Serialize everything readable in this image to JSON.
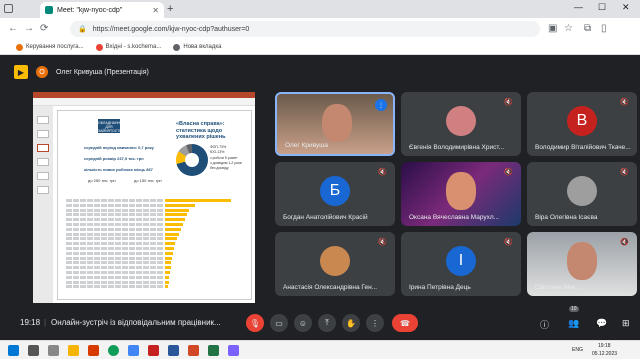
{
  "browser": {
    "tab_title": "Meet: \"kjw-nyoc-cdp\"",
    "url": "https://meet.google.com/kjw-nyoc-cdp?authuser=0",
    "bookmarks": [
      {
        "label": "Керування послуга...",
        "color": "#e8710a"
      },
      {
        "label": "Вхідні - s.kochema...",
        "color": "#ea4335"
      },
      {
        "label": "Нова вкладка",
        "color": "#5f6368"
      }
    ]
  },
  "meet": {
    "presenter_initial": "О",
    "presenter_label": "Олег Кривуша (Презентація)",
    "slide": {
      "logo_text": "ОБЛАДНАННЯ ДЛЯ ЗАЙНЯТОСТІ",
      "title": "«Власна справа»: статистика щодо ухвалених рішень",
      "stats": [
        "середній період навчання: 0,7 року",
        "середній розмір 237,9 тис. грн",
        "кількість нових робочих місць 867",
        "до 250 тис. грн",
        "до 150 тис. грн"
      ],
      "legend": [
        "ФОП-73%",
        "ЮО-13%",
        "з роботи 5 років+",
        "з досвідом 1-2 роки",
        "без досвіду"
      ]
    },
    "tiles": [
      {
        "name": "Олег Кривуша",
        "type": "video",
        "speaking": true
      },
      {
        "name": "Євгенія Володимирівна Христ...",
        "type": "photo",
        "color": "#d08080"
      },
      {
        "name": "Володимир Віталійович Ткаче...",
        "type": "letter",
        "letter": "В",
        "color": "#c5221f"
      },
      {
        "name": "Богдан Анатолійович Красій",
        "type": "letter",
        "letter": "Б",
        "color": "#1967d2"
      },
      {
        "name": "Оксана Вячеславна Марухл...",
        "type": "video"
      },
      {
        "name": "Віра Олегівна Ісаєва",
        "type": "photo",
        "color": "#9e9e9e"
      },
      {
        "name": "Анастасія Олександрівна Ген...",
        "type": "photo",
        "color": "#c98850"
      },
      {
        "name": "Ірина Петрівна Дець",
        "type": "letter",
        "letter": "І",
        "color": "#1967d2"
      },
      {
        "name": "Світлана Мик...",
        "type": "video"
      }
    ],
    "controls": {
      "time": "19:18",
      "separator": "|",
      "title": "Онлайн-зустріч із відповідальним працівник...",
      "participants_count": "10"
    }
  },
  "taskbar": {
    "lang": "ENG",
    "clock_time": "19:18",
    "clock_date": "05.12.2023"
  }
}
